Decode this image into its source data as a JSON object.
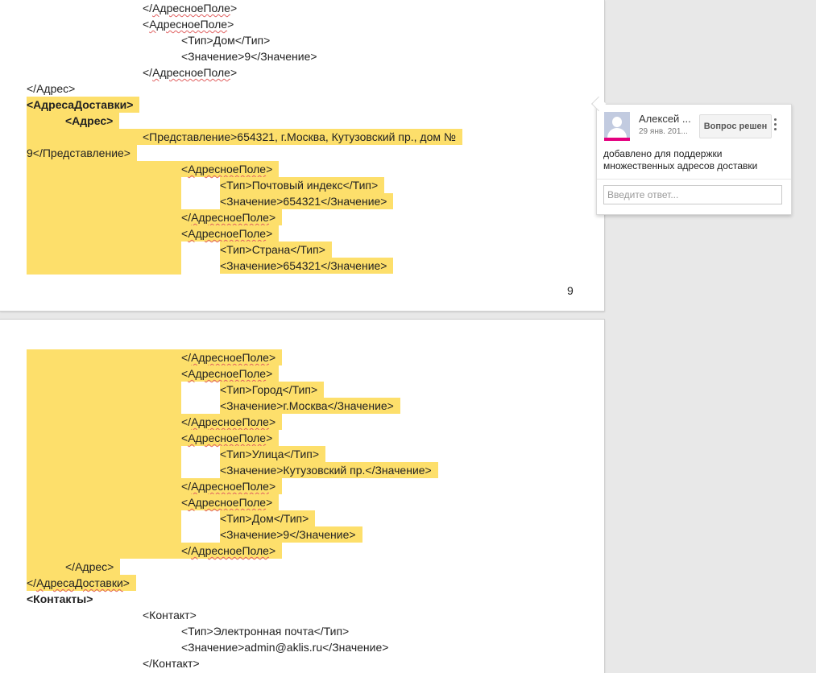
{
  "page1": {
    "lines": [
      {
        "parts": [
          "</",
          {
            "u": "АдресноеПоле"
          },
          ">"
        ]
      },
      {
        "parts": [
          "<",
          {
            "u": "АдресноеПоле"
          },
          ">"
        ]
      },
      {
        "parts": [
          "<Тип>Дом</Тип>"
        ]
      },
      {
        "parts": [
          "<Значение>9</Значение>"
        ]
      },
      {
        "parts": [
          "</",
          {
            "u": "АдресноеПоле"
          },
          ">"
        ]
      },
      {
        "parts": [
          "</Адрес>"
        ]
      },
      {
        "parts": [
          {
            "b": "<АдресаДоставки>"
          }
        ]
      },
      {
        "parts": [
          {
            "b": "<Адрес>"
          }
        ]
      },
      {
        "parts": [
          "<Представление>654321, г.Москва, Кутузовский пр., дом №"
        ]
      },
      {
        "parts": [
          "9</Представление>"
        ]
      },
      {
        "parts": [
          "<",
          {
            "u": "АдресноеПоле"
          },
          ">"
        ]
      },
      {
        "parts": [
          "<Тип>Почтовый индекс</Тип>"
        ]
      },
      {
        "parts": [
          "<Значение>654321</Значение>"
        ]
      },
      {
        "parts": [
          "</",
          {
            "u": "АдресноеПоле"
          },
          ">"
        ]
      },
      {
        "parts": [
          "<",
          {
            "u": "АдресноеПоле"
          },
          ">"
        ]
      },
      {
        "parts": [
          "<Тип>Страна</Тип>"
        ]
      },
      {
        "parts": [
          "<Значение>654321</Значение>"
        ]
      }
    ],
    "page_number": "9"
  },
  "page2": {
    "lines": [
      {
        "parts": [
          "</",
          {
            "u": "АдресноеПоле"
          },
          ">"
        ]
      },
      {
        "parts": [
          "<",
          {
            "u": "АдресноеПоле"
          },
          ">"
        ]
      },
      {
        "parts": [
          "<Тип>Город</Тип>"
        ]
      },
      {
        "parts": [
          "<Значение>г.Москва</Значение>"
        ]
      },
      {
        "parts": [
          "</",
          {
            "u": "АдресноеПоле"
          },
          ">"
        ]
      },
      {
        "parts": [
          "<",
          {
            "u": "АдресноеПоле"
          },
          ">"
        ]
      },
      {
        "parts": [
          "<Тип>Улица</Тип>"
        ]
      },
      {
        "parts": [
          "<Значение>Кутузовский пр.</Значение>"
        ]
      },
      {
        "parts": [
          "</",
          {
            "u": "АдресноеПоле"
          },
          ">"
        ]
      },
      {
        "parts": [
          "<",
          {
            "u": "АдресноеПоле"
          },
          ">"
        ]
      },
      {
        "parts": [
          "<Тип>Дом</Тип>"
        ]
      },
      {
        "parts": [
          "<Значение>9</Значение>"
        ]
      },
      {
        "parts": [
          "</",
          {
            "u": "АдресноеПоле"
          },
          ">"
        ]
      },
      {
        "parts": [
          "</Адрес>"
        ]
      },
      {
        "parts": [
          "</",
          {
            "u": "АдресаДоставки"
          },
          ">"
        ]
      },
      {
        "parts": [
          {
            "b": "<Контакты>"
          }
        ]
      },
      {
        "parts": [
          "<Контакт>"
        ]
      },
      {
        "parts": [
          "<Тип>Электронная почта</Тип>"
        ]
      },
      {
        "parts": [
          "<Значение>admin@aklis.ru</Значение>"
        ]
      },
      {
        "parts": [
          "</Контакт>"
        ]
      }
    ]
  },
  "comment": {
    "author": "Алексей ...",
    "date": "29 янв. 201...",
    "resolve_label": "Вопрос решен",
    "text": "добавлено для поддержки множественных адресов доставки",
    "reply_placeholder": "Введите ответ...",
    "avatar_accent": "#e4007f"
  },
  "colors": {
    "highlight": "#fddf6b"
  }
}
